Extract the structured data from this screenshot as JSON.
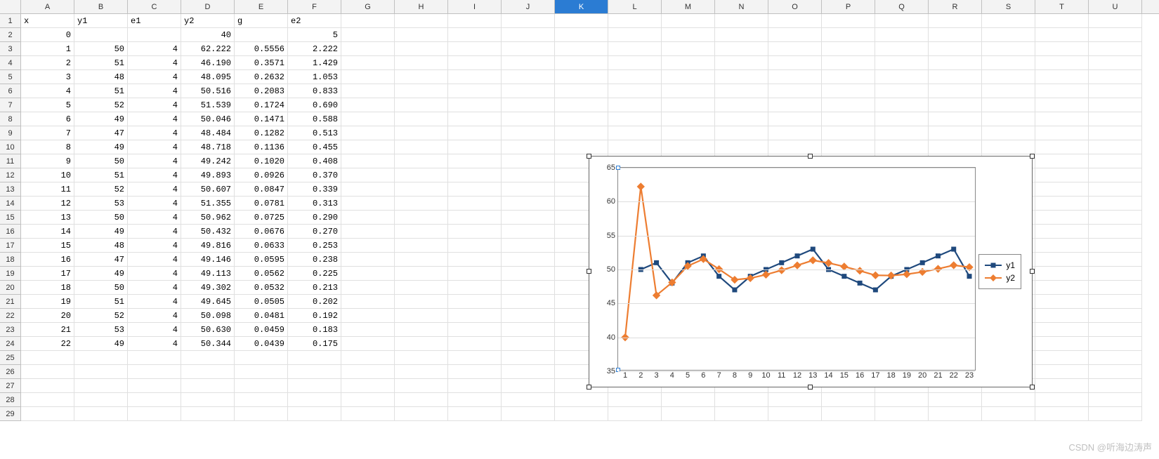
{
  "columns": [
    "A",
    "B",
    "C",
    "D",
    "E",
    "F",
    "G",
    "H",
    "I",
    "J",
    "K",
    "L",
    "M",
    "N",
    "O",
    "P",
    "Q",
    "R",
    "S",
    "T",
    "U"
  ],
  "selected_column": "K",
  "row_count": 29,
  "headers": {
    "A": "x",
    "B": "y1",
    "C": "e1",
    "D": "y2",
    "E": "g",
    "F": "e2"
  },
  "rows": [
    {
      "A": "0",
      "B": "",
      "C": "",
      "D": "40",
      "E": "",
      "F": "5"
    },
    {
      "A": "1",
      "B": "50",
      "C": "4",
      "D": "62.222",
      "E": "0.5556",
      "F": "2.222"
    },
    {
      "A": "2",
      "B": "51",
      "C": "4",
      "D": "46.190",
      "E": "0.3571",
      "F": "1.429"
    },
    {
      "A": "3",
      "B": "48",
      "C": "4",
      "D": "48.095",
      "E": "0.2632",
      "F": "1.053"
    },
    {
      "A": "4",
      "B": "51",
      "C": "4",
      "D": "50.516",
      "E": "0.2083",
      "F": "0.833"
    },
    {
      "A": "5",
      "B": "52",
      "C": "4",
      "D": "51.539",
      "E": "0.1724",
      "F": "0.690"
    },
    {
      "A": "6",
      "B": "49",
      "C": "4",
      "D": "50.046",
      "E": "0.1471",
      "F": "0.588"
    },
    {
      "A": "7",
      "B": "47",
      "C": "4",
      "D": "48.484",
      "E": "0.1282",
      "F": "0.513"
    },
    {
      "A": "8",
      "B": "49",
      "C": "4",
      "D": "48.718",
      "E": "0.1136",
      "F": "0.455"
    },
    {
      "A": "9",
      "B": "50",
      "C": "4",
      "D": "49.242",
      "E": "0.1020",
      "F": "0.408"
    },
    {
      "A": "10",
      "B": "51",
      "C": "4",
      "D": "49.893",
      "E": "0.0926",
      "F": "0.370"
    },
    {
      "A": "11",
      "B": "52",
      "C": "4",
      "D": "50.607",
      "E": "0.0847",
      "F": "0.339"
    },
    {
      "A": "12",
      "B": "53",
      "C": "4",
      "D": "51.355",
      "E": "0.0781",
      "F": "0.313"
    },
    {
      "A": "13",
      "B": "50",
      "C": "4",
      "D": "50.962",
      "E": "0.0725",
      "F": "0.290"
    },
    {
      "A": "14",
      "B": "49",
      "C": "4",
      "D": "50.432",
      "E": "0.0676",
      "F": "0.270"
    },
    {
      "A": "15",
      "B": "48",
      "C": "4",
      "D": "49.816",
      "E": "0.0633",
      "F": "0.253"
    },
    {
      "A": "16",
      "B": "47",
      "C": "4",
      "D": "49.146",
      "E": "0.0595",
      "F": "0.238"
    },
    {
      "A": "17",
      "B": "49",
      "C": "4",
      "D": "49.113",
      "E": "0.0562",
      "F": "0.225"
    },
    {
      "A": "18",
      "B": "50",
      "C": "4",
      "D": "49.302",
      "E": "0.0532",
      "F": "0.213"
    },
    {
      "A": "19",
      "B": "51",
      "C": "4",
      "D": "49.645",
      "E": "0.0505",
      "F": "0.202"
    },
    {
      "A": "20",
      "B": "52",
      "C": "4",
      "D": "50.098",
      "E": "0.0481",
      "F": "0.192"
    },
    {
      "A": "21",
      "B": "53",
      "C": "4",
      "D": "50.630",
      "E": "0.0459",
      "F": "0.183"
    },
    {
      "A": "22",
      "B": "49",
      "C": "4",
      "D": "50.344",
      "E": "0.0439",
      "F": "0.175"
    }
  ],
  "chart_data": {
    "type": "line",
    "x": [
      1,
      2,
      3,
      4,
      5,
      6,
      7,
      8,
      9,
      10,
      11,
      12,
      13,
      14,
      15,
      16,
      17,
      18,
      19,
      20,
      21,
      22,
      23
    ],
    "series": [
      {
        "name": "y1",
        "color": "#1f497d",
        "marker": "square",
        "values": [
          null,
          50,
          51,
          48,
          51,
          52,
          49,
          47,
          49,
          50,
          51,
          52,
          53,
          50,
          49,
          48,
          47,
          49,
          50,
          51,
          52,
          53,
          49
        ]
      },
      {
        "name": "y2",
        "color": "#ed7d31",
        "marker": "diamond",
        "values": [
          40,
          62.222,
          46.19,
          48.095,
          50.516,
          51.539,
          50.046,
          48.484,
          48.718,
          49.242,
          49.893,
          50.607,
          51.355,
          50.962,
          50.432,
          49.816,
          49.146,
          49.113,
          49.302,
          49.645,
          50.098,
          50.63,
          50.344
        ]
      }
    ],
    "y_ticks": [
      35,
      40,
      45,
      50,
      55,
      60,
      65
    ],
    "ylim": [
      35,
      65
    ],
    "xlim": [
      1,
      23
    ],
    "legend": {
      "position": "right"
    }
  },
  "watermark": "CSDN @听海边涛声"
}
